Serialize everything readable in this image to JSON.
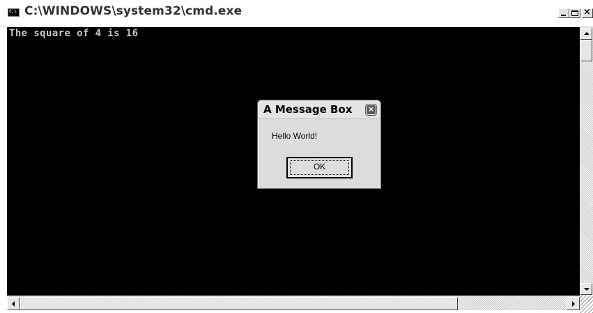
{
  "window": {
    "title": "C:\\WINDOWS\\system32\\cmd.exe",
    "icon": "console-app-icon",
    "icon_text": "C:\\",
    "caption_buttons": {
      "minimize_icon": "minimize-icon",
      "maximize_icon": "maximize-icon",
      "close_icon": "close-icon",
      "close_glyph": "×"
    }
  },
  "console": {
    "output_line": "The square of 4 is 16",
    "background": "#000000",
    "foreground": "#c0c0c0"
  },
  "scrollbars": {
    "vertical": {
      "up_icon": "arrow-up-icon",
      "down_icon": "arrow-down-icon"
    },
    "horizontal": {
      "left_icon": "arrow-left-icon",
      "right_icon": "arrow-right-icon"
    }
  },
  "dialog": {
    "title": "A Message Box",
    "message": "Hello World!",
    "ok_label": "OK",
    "close_glyph": "×"
  }
}
